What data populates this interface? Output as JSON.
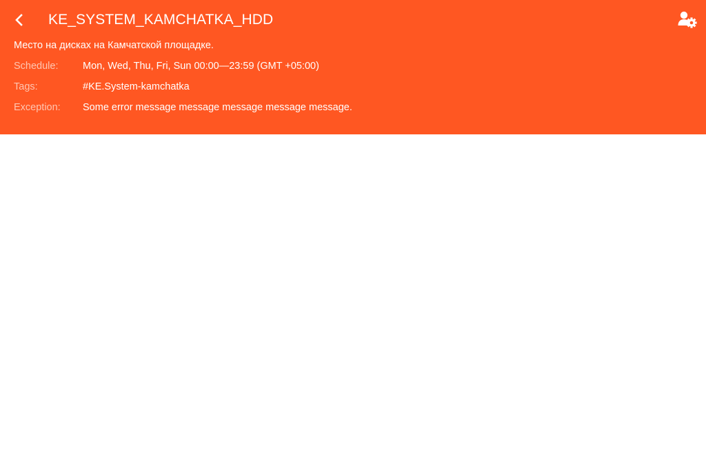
{
  "header": {
    "title": "KE_SYSTEM_KAMCHATKA_HDD",
    "description": "Место на дисках на Камчатской площадке.",
    "background_color": "#ff5722",
    "back_icon": "chevron-left-icon",
    "settings_icon": "user-settings-icon",
    "fields": {
      "schedule": {
        "label": "Schedule:",
        "value": "Mon, Wed, Thu, Fri, Sun 00:00—23:59 (GMT +05:00)"
      },
      "tags": {
        "label": "Tags:",
        "value": "#KE.System-kamchatka"
      },
      "exception": {
        "label": "Exception:",
        "value": "Some error message message message message message."
      }
    }
  }
}
